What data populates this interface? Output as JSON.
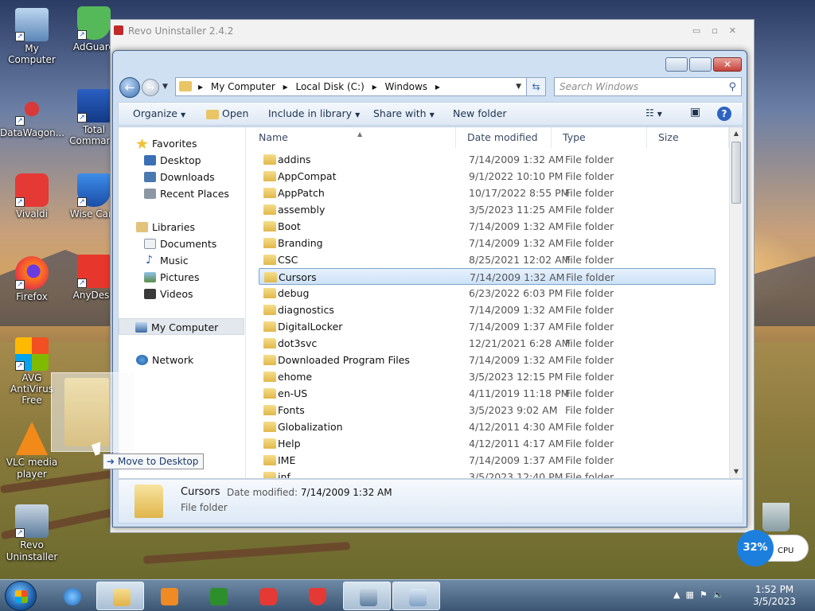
{
  "desktop": {
    "icons": [
      {
        "label": "My Computer",
        "icon": "computer-icon"
      },
      {
        "label": "AdGuard",
        "icon": "adguard-icon"
      },
      {
        "label": "DataWagon...",
        "icon": "datawagon-icon"
      },
      {
        "label": "Total Command",
        "icon": "total-commander-icon"
      },
      {
        "label": "Vivaldi",
        "icon": "vivaldi-icon"
      },
      {
        "label": "Wise Care",
        "icon": "wise-care-icon"
      },
      {
        "label": "Firefox",
        "icon": "firefox-icon"
      },
      {
        "label": "AnyDesk",
        "icon": "anydesk-icon"
      },
      {
        "label": "AVG AntiVirus Free",
        "icon": "avg-icon"
      },
      {
        "label": "VLC media player",
        "icon": "vlc-icon"
      },
      {
        "label": "Revo Uninstaller",
        "icon": "revo-icon"
      }
    ]
  },
  "revo": {
    "title": "Revo Uninstaller 2.4.2"
  },
  "explorer": {
    "address": {
      "crumbs": [
        "My Computer",
        "Local Disk (C:)",
        "Windows"
      ]
    },
    "search_placeholder": "Search Windows",
    "toolbar": {
      "organize": "Organize",
      "open": "Open",
      "include": "Include in library",
      "share": "Share with",
      "new_folder": "New folder"
    },
    "nav": {
      "favorites": "Favorites",
      "desktop": "Desktop",
      "downloads": "Downloads",
      "recent": "Recent Places",
      "libraries": "Libraries",
      "documents": "Documents",
      "music": "Music",
      "pictures": "Pictures",
      "videos": "Videos",
      "my_computer": "My Computer",
      "network": "Network"
    },
    "columns": {
      "name": "Name",
      "date": "Date modified",
      "type": "Type",
      "size": "Size"
    },
    "rows": [
      {
        "name": "addins",
        "date": "7/14/2009 1:32 AM",
        "type": "File folder"
      },
      {
        "name": "AppCompat",
        "date": "9/1/2022 10:10 PM",
        "type": "File folder"
      },
      {
        "name": "AppPatch",
        "date": "10/17/2022 8:55 PM",
        "type": "File folder"
      },
      {
        "name": "assembly",
        "date": "3/5/2023 11:25 AM",
        "type": "File folder"
      },
      {
        "name": "Boot",
        "date": "7/14/2009 1:32 AM",
        "type": "File folder"
      },
      {
        "name": "Branding",
        "date": "7/14/2009 1:32 AM",
        "type": "File folder"
      },
      {
        "name": "CSC",
        "date": "8/25/2021 12:02 AM",
        "type": "File folder"
      },
      {
        "name": "Cursors",
        "date": "7/14/2009 1:32 AM",
        "type": "File folder"
      },
      {
        "name": "debug",
        "date": "6/23/2022 6:03 PM",
        "type": "File folder"
      },
      {
        "name": "diagnostics",
        "date": "7/14/2009 1:32 AM",
        "type": "File folder"
      },
      {
        "name": "DigitalLocker",
        "date": "7/14/2009 1:37 AM",
        "type": "File folder"
      },
      {
        "name": "dot3svc",
        "date": "12/21/2021 6:28 AM",
        "type": "File folder"
      },
      {
        "name": "Downloaded Program Files",
        "date": "7/14/2009 1:32 AM",
        "type": "File folder"
      },
      {
        "name": "ehome",
        "date": "3/5/2023 12:15 PM",
        "type": "File folder"
      },
      {
        "name": "en-US",
        "date": "4/11/2019 11:18 PM",
        "type": "File folder"
      },
      {
        "name": "Fonts",
        "date": "3/5/2023 9:02 AM",
        "type": "File folder"
      },
      {
        "name": "Globalization",
        "date": "4/12/2011 4:30 AM",
        "type": "File folder"
      },
      {
        "name": "Help",
        "date": "4/12/2011 4:17 AM",
        "type": "File folder"
      },
      {
        "name": "IME",
        "date": "7/14/2009 1:37 AM",
        "type": "File folder"
      },
      {
        "name": "inf",
        "date": "3/5/2023 12:40 PM",
        "type": "File folder"
      }
    ],
    "selected_index": 7,
    "details": {
      "name": "Cursors",
      "date_label": "Date modified:",
      "date_value": "7/14/2009 1:32 AM",
      "type": "File folder"
    }
  },
  "drag": {
    "tooltip": "Move to Desktop"
  },
  "taskbar": {
    "apps": [
      "explorer-icon",
      "ie-icon",
      "media-player-icon",
      "csharp-icon",
      "vivaldi-icon",
      "adguard-icon",
      "revo-icon",
      "control-panel-icon"
    ],
    "time": "1:52 PM",
    "date": "3/5/2023"
  },
  "cpu_widget": {
    "percent": "32%",
    "label": "CPU"
  }
}
